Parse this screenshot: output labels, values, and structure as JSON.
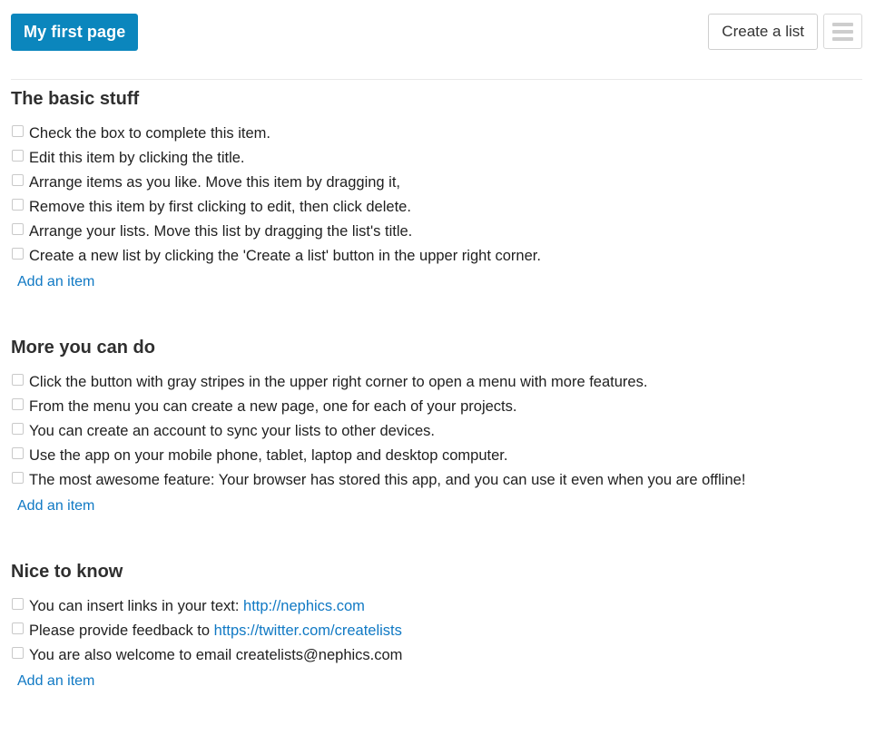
{
  "header": {
    "page_title": "My first page",
    "create_list_label": "Create a list",
    "menu_icon": "hamburger-menu-icon",
    "accent_color": "#0b86bd",
    "link_color": "#1079c4"
  },
  "add_item_label": "Add an item",
  "lists": [
    {
      "title": "The basic stuff",
      "items": [
        {
          "checked": false,
          "parts": [
            {
              "type": "text",
              "value": "Check the box to complete this item."
            }
          ]
        },
        {
          "checked": false,
          "parts": [
            {
              "type": "text",
              "value": "Edit this item by clicking the title."
            }
          ]
        },
        {
          "checked": false,
          "parts": [
            {
              "type": "text",
              "value": "Arrange items as you like. Move this item by dragging it,"
            }
          ]
        },
        {
          "checked": false,
          "parts": [
            {
              "type": "text",
              "value": "Remove this item by first clicking to edit, then click delete."
            }
          ]
        },
        {
          "checked": false,
          "parts": [
            {
              "type": "text",
              "value": "Arrange your lists. Move this list by dragging the list's title."
            }
          ]
        },
        {
          "checked": false,
          "parts": [
            {
              "type": "text",
              "value": "Create a new list by clicking the 'Create a list' button in the upper right corner."
            }
          ]
        }
      ]
    },
    {
      "title": "More you can do",
      "items": [
        {
          "checked": false,
          "parts": [
            {
              "type": "text",
              "value": "Click the button with gray stripes in the upper right corner to open a menu with more features."
            }
          ]
        },
        {
          "checked": false,
          "parts": [
            {
              "type": "text",
              "value": "From the menu you can create a new page, one for each of your projects."
            }
          ]
        },
        {
          "checked": false,
          "parts": [
            {
              "type": "text",
              "value": "You can create an account to sync your lists to other devices."
            }
          ]
        },
        {
          "checked": false,
          "parts": [
            {
              "type": "text",
              "value": "Use the app on your mobile phone, tablet, laptop and desktop computer."
            }
          ]
        },
        {
          "checked": false,
          "parts": [
            {
              "type": "text",
              "value": "The most awesome feature: Your browser has stored this app, and you can use it even when you are offline!"
            }
          ]
        }
      ]
    },
    {
      "title": "Nice to know",
      "items": [
        {
          "checked": false,
          "parts": [
            {
              "type": "text",
              "value": "You can insert links in your text: "
            },
            {
              "type": "link",
              "value": "http://nephics.com"
            }
          ]
        },
        {
          "checked": false,
          "parts": [
            {
              "type": "text",
              "value": "Please provide feedback to "
            },
            {
              "type": "link",
              "value": "https://twitter.com/createlists"
            }
          ]
        },
        {
          "checked": false,
          "parts": [
            {
              "type": "text",
              "value": "You are also welcome to email createlists@nephics.com"
            }
          ]
        }
      ]
    }
  ]
}
